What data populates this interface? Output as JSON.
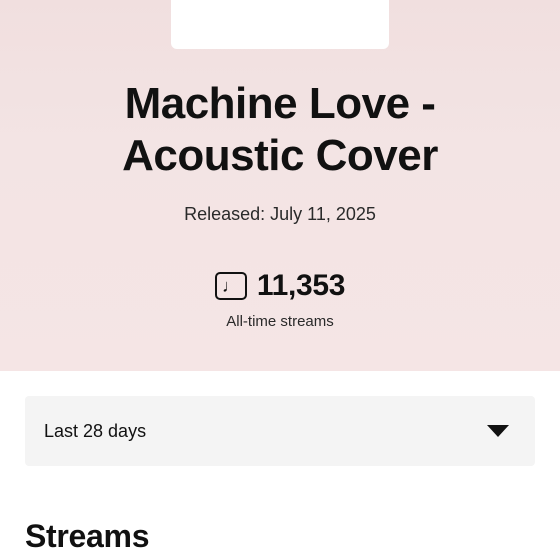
{
  "track": {
    "title_line1": "Machine Love -",
    "title_line2": "Acoustic Cover",
    "released": "Released: July 11, 2025"
  },
  "stats": {
    "icon": "music-note-icon",
    "streams_total": "11,353",
    "streams_label": "All-time streams"
  },
  "filter": {
    "selected": "Last 28 days"
  },
  "sections": {
    "streams_title": "Streams"
  },
  "colors": {
    "hero_background": "#f3e4e4",
    "text": "#111111",
    "select_background": "#f4f4f4"
  }
}
